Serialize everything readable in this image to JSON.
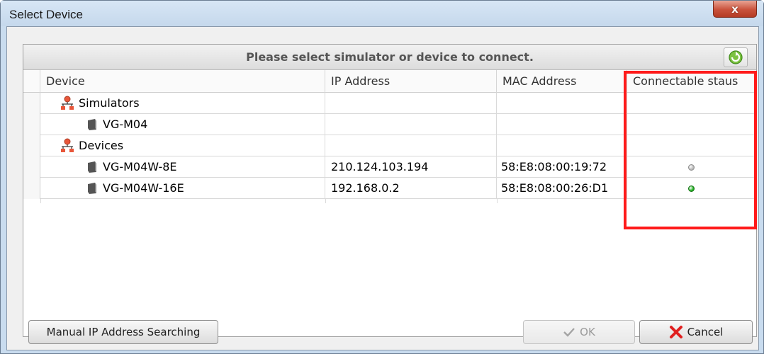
{
  "window": {
    "title": "Select Device",
    "close_label": "x"
  },
  "panel": {
    "header": "Please select simulator or device to connect."
  },
  "columns": [
    "Device",
    "IP Address",
    "MAC Address",
    "Connectable staus"
  ],
  "rows": [
    {
      "kind": "group",
      "name": "Simulators",
      "ip": "",
      "mac": "",
      "status": ""
    },
    {
      "kind": "device",
      "name": "VG-M04",
      "ip": "",
      "mac": "",
      "status": ""
    },
    {
      "kind": "group",
      "name": "Devices",
      "ip": "",
      "mac": "",
      "status": ""
    },
    {
      "kind": "device",
      "name": "VG-M04W-8E",
      "ip": "210.124.103.194",
      "mac": "58:E8:08:00:19:72",
      "status": "unavailable"
    },
    {
      "kind": "device",
      "name": "VG-M04W-16E",
      "ip": "192.168.0.2",
      "mac": "58:E8:08:00:26:D1",
      "status": "connectable"
    }
  ],
  "status_colors": {
    "unavailable": "#b8b8b8",
    "connectable": "#22b022"
  },
  "buttons": {
    "manual_search": "Manual IP Address Searching",
    "ok": "OK",
    "cancel": "Cancel"
  },
  "icons": {
    "group": "network-tree-icon",
    "device": "device-icon",
    "refresh": "refresh-icon",
    "ok": "checkmark-icon",
    "cancel": "red-x-icon"
  },
  "colors": {
    "highlight": "#ff1a1a"
  }
}
